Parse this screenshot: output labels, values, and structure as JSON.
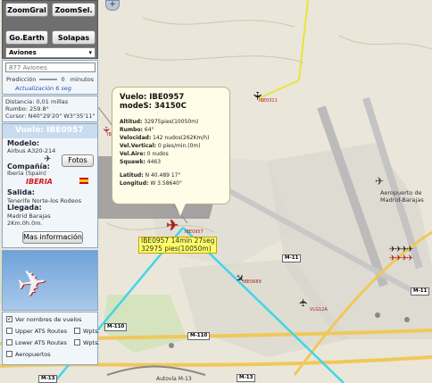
{
  "toolbar": {
    "zoom_gral": "ZoomGral",
    "zoom_sel": "ZoomSel.",
    "go_earth": "Go.Earth",
    "tabs": "Solapas",
    "filter_select": "Aviones",
    "count_select": "877 Aviones"
  },
  "prediction": {
    "label": "Predicción",
    "value": "0",
    "unit": "minutos",
    "update": "Actualización 6 seg"
  },
  "stats": {
    "distance": "Distancia: 0,01 millas",
    "heading": "Rumbo: 259.8°",
    "cursor": "Cursor: N40°29'20\" W3°35'11\""
  },
  "popup": {
    "flight": "Vuelo: IBE0957",
    "modes": "modeS: 34150C",
    "altitude_label": "Altitud:",
    "altitude": "32975pies(10050m)",
    "heading_label": "Rumbo:",
    "heading": "64°",
    "speed_label": "Velocidad:",
    "speed": "142 nudos(262Km/h)",
    "vspeed_label": "Vel.Vertical:",
    "vspeed": "0 pies/min.(0m)",
    "airspeed_label": "Vel.Aire:",
    "airspeed": "0 nudos",
    "squawk_label": "Squawk:",
    "squawk": "4463",
    "lat_label": "Latitud:",
    "lat": "N 40.489 17°",
    "lon_label": "Longitud:",
    "lon": "W 3.58640°"
  },
  "flight_label": {
    "line1": "IBE0957 14min 27seg",
    "line2": "32975 pies(10050m)"
  },
  "info": {
    "title": "Vuelo: IBE0957",
    "model_label": "Modelo:",
    "model": "Airbus A320-214",
    "company_label": "Compañía:",
    "company": "Iberia (Spain)",
    "photos": "Fotos",
    "departure_label": "Salida:",
    "departure": "Tenerife Norte-los Rodeos",
    "arrival_label": "Llegada:",
    "arrival": "Madrid Barajas",
    "distance": "2Km.0h.0m.",
    "more": "Mas información"
  },
  "options": {
    "show_names": "Ver nombres de vuelos",
    "upper_ats": "Upper ATS Routes",
    "lower_ats": "Lower ATS Routes",
    "wpts1": "Wpts.",
    "wpts2": "Wpts.",
    "airports": "Aeropuertos"
  },
  "map": {
    "airport": "Aeropuerto de Madrid-Barajas",
    "roads": [
      "M-11",
      "M-11",
      "M-110",
      "M-110",
      "M-13",
      "M-13"
    ],
    "road_label": "Autovía M-13",
    "plane_labels": [
      "IBE0311",
      "IBE0957",
      "IBE0689",
      "IBE0525",
      "VLG12A"
    ]
  },
  "colors": {
    "panel": "#c9dcef",
    "route_cyan": "#3fd6e6",
    "route_yellow": "#e6e63a",
    "highlight": "#ffff66"
  }
}
